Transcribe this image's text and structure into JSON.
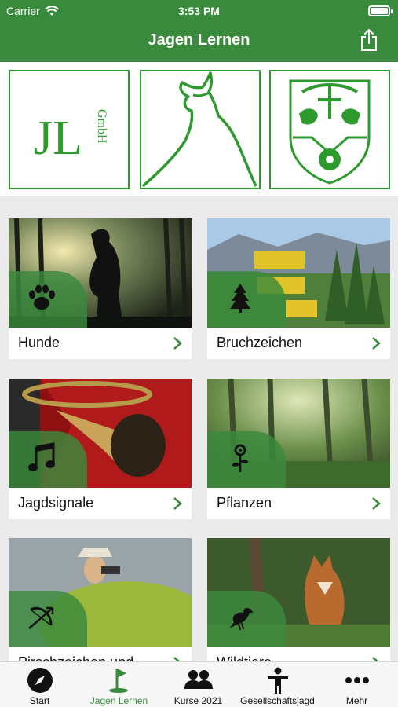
{
  "status_bar": {
    "carrier": "Carrier",
    "time": "3:53 PM"
  },
  "header": {
    "title": "Jagen Lernen"
  },
  "logos": {
    "jl_text": "JL",
    "gmbh_text": "GmbH"
  },
  "tiles": [
    {
      "label": "Hunde",
      "icon": "paw-icon"
    },
    {
      "label": "Bruchzeichen",
      "icon": "tree-icon"
    },
    {
      "label": "Jagdsignale",
      "icon": "music-note-icon"
    },
    {
      "label": "Pflanzen",
      "icon": "flower-icon"
    },
    {
      "label": "Pirschzeichen und",
      "icon": "bow-icon"
    },
    {
      "label": "Wildtiere",
      "icon": "bird-icon"
    }
  ],
  "tabbar": [
    {
      "label": "Start",
      "icon": "compass-icon"
    },
    {
      "label": "Jagen Lernen",
      "icon": "golf-flag-icon",
      "active": true
    },
    {
      "label": "Kurse 2021",
      "icon": "people-icon"
    },
    {
      "label": "Gesellschaftsjagd",
      "icon": "person-icon"
    },
    {
      "label": "Mehr",
      "icon": "more-icon"
    }
  ],
  "colors": {
    "brand_green": "#3a8a3d",
    "logo_green": "#2d9a2d"
  }
}
